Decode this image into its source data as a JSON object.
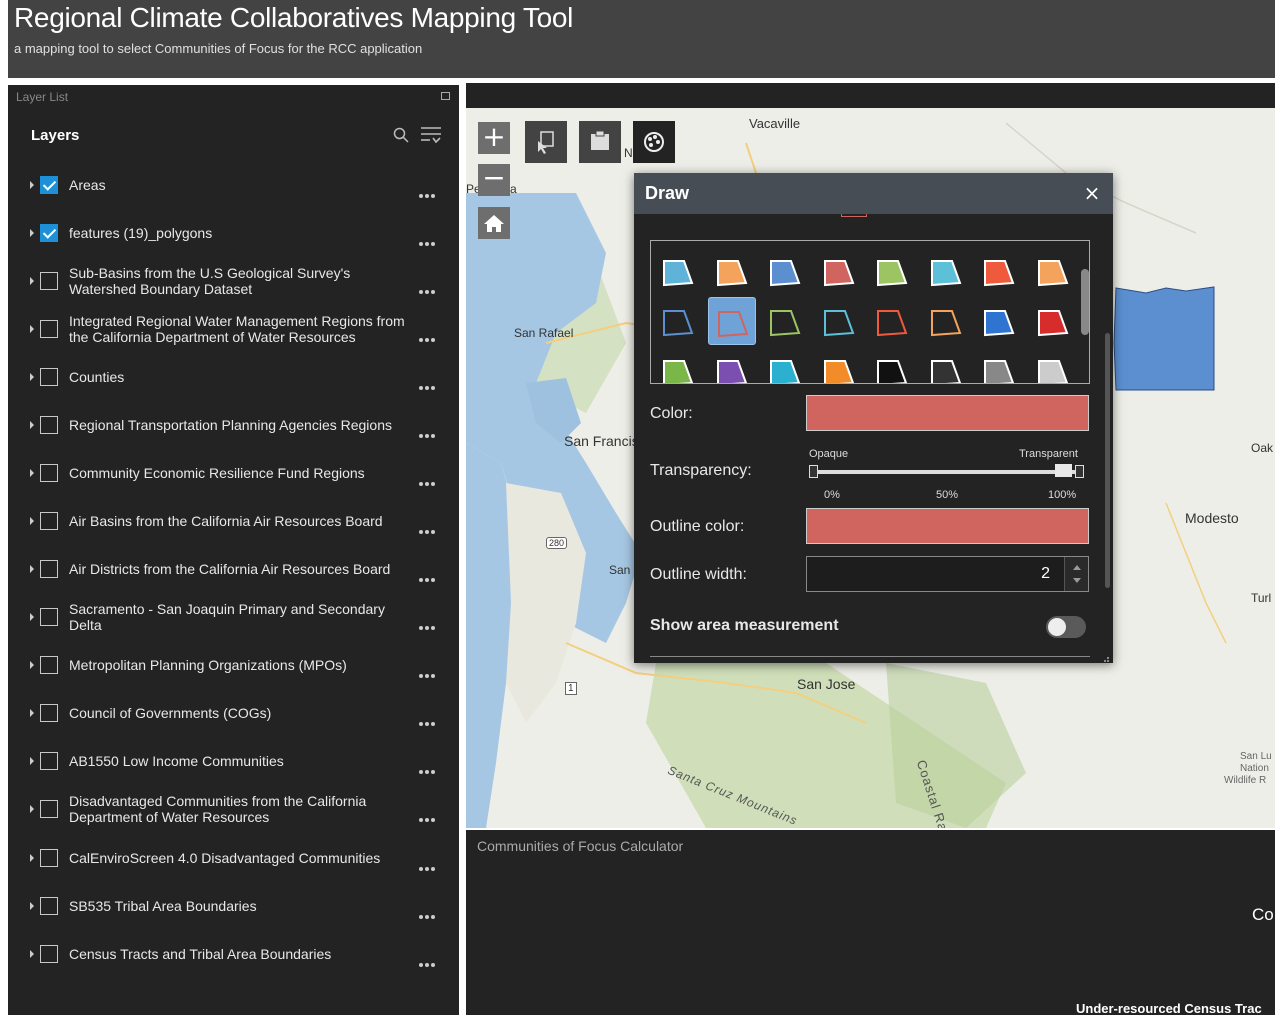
{
  "app": {
    "title": "Regional Climate Collaboratives Mapping Tool",
    "subtitle": "a mapping tool to select Communities of Focus for the RCC application"
  },
  "layer_panel": {
    "title": "Layer List",
    "heading": "Layers",
    "items": [
      {
        "label": "Areas",
        "checked": true
      },
      {
        "label": "features (19)_polygons",
        "checked": true
      },
      {
        "label": "Sub-Basins from the U.S Geological Survey's Watershed Boundary Dataset",
        "checked": false
      },
      {
        "label": "Integrated Regional Water Management Regions from the California Department of Water Resources",
        "checked": false
      },
      {
        "label": "Counties",
        "checked": false
      },
      {
        "label": "Regional Transportation Planning Agencies Regions",
        "checked": false
      },
      {
        "label": "Community Economic Resilience Fund Regions",
        "checked": false
      },
      {
        "label": "Air Basins from the California Air Resources Board",
        "checked": false
      },
      {
        "label": "Air Districts from the California Air Resources Board",
        "checked": false
      },
      {
        "label": "Sacramento - San Joaquin Primary and Secondary Delta",
        "checked": false
      },
      {
        "label": "Metropolitan Planning Organizations (MPOs)",
        "checked": false
      },
      {
        "label": "Council of Governments (COGs)",
        "checked": false
      },
      {
        "label": "AB1550 Low Income Communities",
        "checked": false
      },
      {
        "label": "Disadvantaged Communities from the California Department of Water Resources",
        "checked": false
      },
      {
        "label": "CalEnviroScreen 4.0 Disadvantaged Communities",
        "checked": false
      },
      {
        "label": "SB535 Tribal Area Boundaries",
        "checked": false
      },
      {
        "label": "Census Tracts and Tribal Area Boundaries",
        "checked": false
      }
    ]
  },
  "map": {
    "zoom_in": "+",
    "zoom_out": "−",
    "labels": {
      "vacaville": "Vacaville",
      "petaluma": "Petaluma",
      "n": "N",
      "san_rafael": "San Rafael",
      "san_francisco": "San Francis",
      "san": "San",
      "san_jose": "San Jose",
      "modesto": "Modesto",
      "oak": "Oak",
      "turl": "Turl",
      "coastal_range": "Coastal Rang",
      "santa_cruz_mountains": "Santa Cruz Mountains",
      "san_luis": "San Lu",
      "nation": "Nation",
      "wildlife": "Wildlife R",
      "shield_280": "280",
      "shield_1": "1"
    }
  },
  "draw_dialog": {
    "title": "Draw",
    "close_symbol": "×",
    "color_label": "Color:",
    "transparency_label": "Transparency:",
    "opaque_label": "Opaque",
    "transparent_label": "Transparent",
    "ticks": [
      "0%",
      "50%",
      "100%"
    ],
    "transparency_value_percent": 100,
    "outline_color_label": "Outline color:",
    "outline_width_label": "Outline width:",
    "outline_width_value": "2",
    "show_area_label": "Show area measurement",
    "fill_color": "#d0645f",
    "outline_color": "#d0645f",
    "palette_colors_row1": [
      "#5fb3d9",
      "#f4a35c",
      "#5b8fd0",
      "#d0645f",
      "#9cc463",
      "#5bc0d8",
      "#f05a3c",
      "#f4a35c"
    ],
    "palette_colors_row2": [
      "#5b8fd0",
      "#d0645f",
      "#9cc463",
      "#5bc0d8",
      "#f05a3c",
      "#f4a35c",
      "#2f74d0",
      "#d62c2c"
    ],
    "palette_colors_row3": [
      "#7ab648",
      "#7b4fb0",
      "#2bb0d0",
      "#f28c28",
      "#111111",
      "#333333",
      "#888888",
      "#cccccc"
    ]
  },
  "bottom_panel": {
    "title": "Communities of Focus Calculator",
    "partial_heading": "Co",
    "partial_text": "Under-resourced Census Trac"
  }
}
